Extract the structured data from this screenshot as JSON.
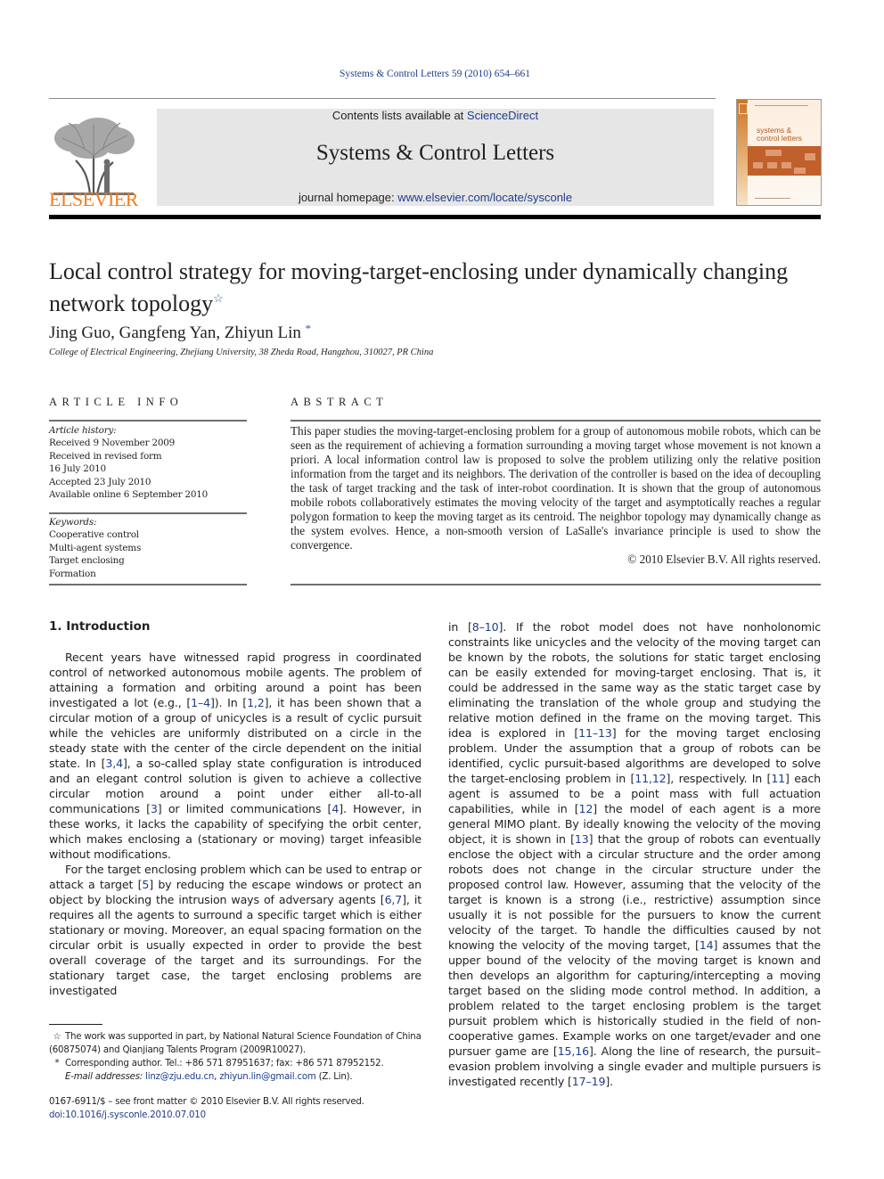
{
  "header": {
    "journal_ref": "Systems & Control Letters 59 (2010) 654–661",
    "contents_prefix": "Contents lists available at ",
    "contents_link": "ScienceDirect",
    "journal_title": "Systems & Control Letters",
    "homepage_prefix": "journal homepage: ",
    "homepage_link": "www.elsevier.com/locate/sysconle",
    "publisher_logo_text": "ELSEVIER",
    "cover_title_line1": "systems &",
    "cover_title_line2": "control letters"
  },
  "article": {
    "title_line1": "Local control strategy for moving-target-enclosing under dynamically changing",
    "title_line2": "network topology",
    "title_mark": "☆",
    "authors": "Jing Guo, Gangfeng Yan, Zhiyun Lin",
    "author_mark": "*",
    "affiliation": "College of Electrical Engineering, Zhejiang University, 38 Zheda Road, Hangzhou, 310027, PR China"
  },
  "article_info": {
    "heading": "ARTICLE INFO",
    "history_label": "Article history:",
    "history": [
      "Received 9 November 2009",
      "Received in revised form",
      "16 July 2010",
      "Accepted 23 July 2010",
      "Available online 6 September 2010"
    ],
    "keywords_label": "Keywords:",
    "keywords": [
      "Cooperative control",
      "Multi-agent systems",
      "Target enclosing",
      "Formation"
    ]
  },
  "abstract": {
    "heading": "ABSTRACT",
    "text": "This paper studies the moving-target-enclosing problem for a group of autonomous mobile robots, which can be seen as the requirement of achieving a formation surrounding a moving target whose movement is not known a priori. A local information control law is proposed to solve the problem utilizing only the relative position information from the target and its neighbors. The derivation of the controller is based on the idea of decoupling the task of target tracking and the task of inter-robot coordination. It is shown that the group of autonomous mobile robots collaboratively estimates the moving velocity of the target and asymptotically reaches a regular polygon formation to keep the moving target as its centroid. The neighbor topology may dynamically change as the system evolves. Hence, a non-smooth version of LaSalle's invariance principle is used to show the convergence.",
    "copyright": "© 2010 Elsevier B.V. All rights reserved."
  },
  "intro": {
    "heading": "1.  Introduction",
    "p1": [
      {
        "t": "Recent years have witnessed rapid progress in coordinated control of networked autonomous mobile agents. The problem of attaining a formation and orbiting around a point has been investigated a lot (e.g., ["
      },
      {
        "t": "1–4",
        "ref": true
      },
      {
        "t": "]). In ["
      },
      {
        "t": "1,2",
        "ref": true
      },
      {
        "t": "], it has been shown that a circular motion of a group of unicycles is a result of cyclic pursuit while the vehicles are uniformly distributed on a circle in the steady state with the center of the circle dependent on the initial state. In ["
      },
      {
        "t": "3,4",
        "ref": true
      },
      {
        "t": "], a so-called splay state configuration is introduced and an elegant control solution is given to achieve a collective circular motion around a point under either all-to-all communications ["
      },
      {
        "t": "3",
        "ref": true
      },
      {
        "t": "] or limited communications ["
      },
      {
        "t": "4",
        "ref": true
      },
      {
        "t": "]. However, in these works, it lacks the capability of specifying the orbit center, which makes enclosing a (stationary or moving) target infeasible without modifications."
      }
    ],
    "p2": [
      {
        "t": "For the target enclosing problem which can be used to entrap or attack a target ["
      },
      {
        "t": "5",
        "ref": true
      },
      {
        "t": "] by reducing the escape windows or protect an object by blocking the intrusion ways of adversary agents ["
      },
      {
        "t": "6,7",
        "ref": true
      },
      {
        "t": "], it requires all the agents to surround a specific target which is either stationary or moving. Moreover, an equal spacing formation on the circular orbit is usually expected in order to provide the best overall coverage of the target and its surroundings. For the stationary target case, the target enclosing problems are investigated"
      }
    ],
    "p3": [
      {
        "t": "in ["
      },
      {
        "t": "8–10",
        "ref": true
      },
      {
        "t": "]. If the robot model does not have nonholonomic constraints like unicycles and the velocity of the moving target can be known by the robots, the solutions for static target enclosing can be easily extended for moving-target enclosing. That is, it could be addressed in the same way as the static target case by eliminating the translation of the whole group and studying the relative motion defined in the frame on the moving target. This idea is explored in ["
      },
      {
        "t": "11–13",
        "ref": true
      },
      {
        "t": "] for the moving target enclosing problem. Under the assumption that a group of robots can be identified, cyclic pursuit-based algorithms are developed to solve the target-enclosing problem in ["
      },
      {
        "t": "11,12",
        "ref": true
      },
      {
        "t": "], respectively. In ["
      },
      {
        "t": "11",
        "ref": true
      },
      {
        "t": "] each agent is assumed to be a point mass with full actuation capabilities, while in ["
      },
      {
        "t": "12",
        "ref": true
      },
      {
        "t": "] the model of each agent is a more general MIMO plant. By ideally knowing the velocity of the moving object, it is shown in ["
      },
      {
        "t": "13",
        "ref": true
      },
      {
        "t": "] that the group of robots can eventually enclose the object with a circular structure and the order among robots does not change in the circular structure under the proposed control law. However, assuming that the velocity of the target is known is a strong (i.e., restrictive) assumption since usually it is not possible for the pursuers to know the current velocity of the target. To handle the difficulties caused by not knowing the velocity of the moving target, ["
      },
      {
        "t": "14",
        "ref": true
      },
      {
        "t": "] assumes that the upper bound of the velocity of the moving target is known and then develops an algorithm for capturing/intercepting a moving target based on the sliding mode control method. In addition, a problem related to the target enclosing problem is the target pursuit problem which is historically studied in the field of non-cooperative games. Example works on one target/evader and one pursuer game are ["
      },
      {
        "t": "15,16",
        "ref": true
      },
      {
        "t": "]. Along the line of research, the pursuit–evasion problem involving a single evader and multiple pursuers is investigated recently ["
      },
      {
        "t": "17–19",
        "ref": true
      },
      {
        "t": "]."
      }
    ]
  },
  "footnotes": {
    "star_mark": "☆",
    "star_text": "The work was supported in part, by National Natural Science Foundation of China (60875074) and Qianjiang Talents Program (2009R10027).",
    "author_mark": "*",
    "author_text": "Corresponding author. Tel.: +86 571 87951637; fax: +86 571 87952152.",
    "email_label": "E-mail addresses:",
    "email1": "linz@zju.edu.cn",
    "email_sep": ", ",
    "email2": "zhiyun.lin@gmail.com",
    "email_suffix": " (Z. Lin).",
    "issn": "0167-6911/$ – see front matter © 2010 Elsevier B.V. All rights reserved.",
    "doi": "doi:10.1016/j.sysconle.2010.07.010"
  },
  "colors": {
    "link": "#1f3d8c",
    "elsevier_orange": "#f07d1f",
    "banner_bg": "#e6e6e6"
  }
}
